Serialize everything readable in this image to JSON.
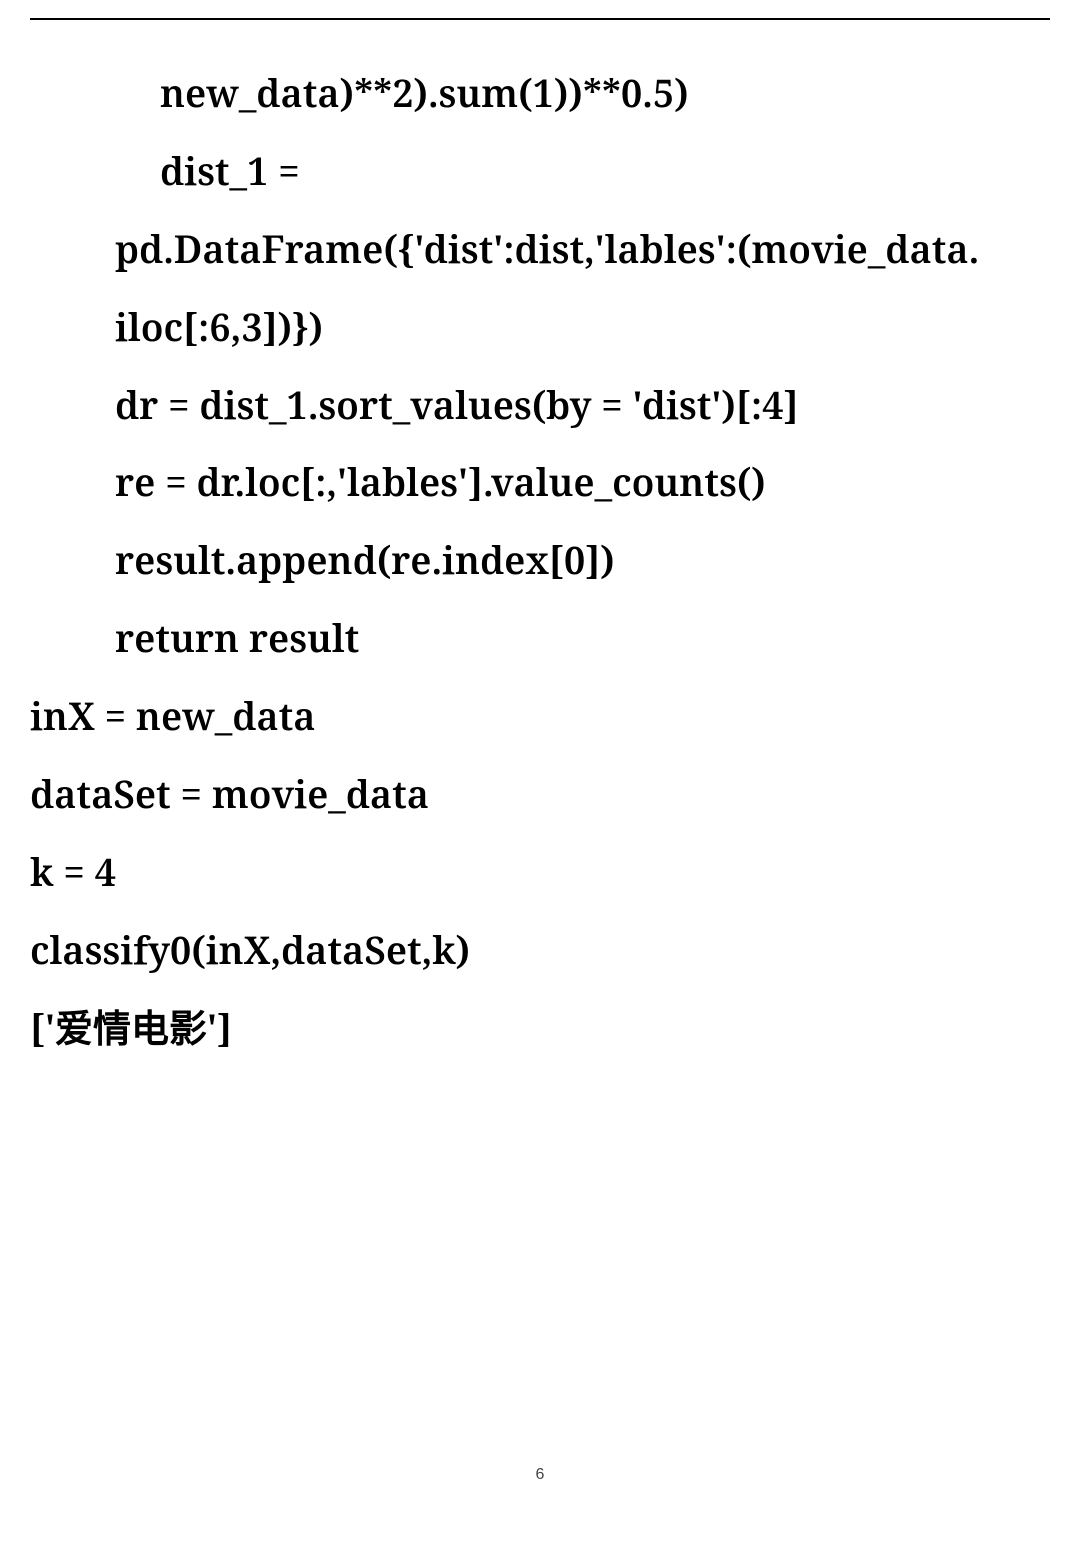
{
  "lines": [
    {
      "cls": "indent2",
      "text": "new_data)**2).sum(1))**0.5)"
    },
    {
      "cls": "indent2",
      "text": "dist_1 ="
    },
    {
      "cls": "indent1",
      "text": "pd.DataFrame({'dist':dist,'lables':(movie_data."
    },
    {
      "cls": "indent1",
      "text": "iloc[:6,3])})"
    },
    {
      "cls": "indent1",
      "text": "dr = dist_1.sort_values(by = 'dist')[:4]"
    },
    {
      "cls": "indent1",
      "text": "re = dr.loc[:,'lables'].value_counts()"
    },
    {
      "cls": "indent1",
      "text": "result.append(re.index[0])"
    },
    {
      "cls": "indent1",
      "text": "return result"
    },
    {
      "cls": "noindent",
      "text": "inX = new_data"
    },
    {
      "cls": "noindent",
      "text": "dataSet = movie_data"
    },
    {
      "cls": "noindent",
      "text": "k = 4"
    },
    {
      "cls": "noindent",
      "text": "classify0(inX,dataSet,k)"
    },
    {
      "cls": "noindent",
      "text": "['爱情电影']"
    }
  ],
  "page_number": "6"
}
